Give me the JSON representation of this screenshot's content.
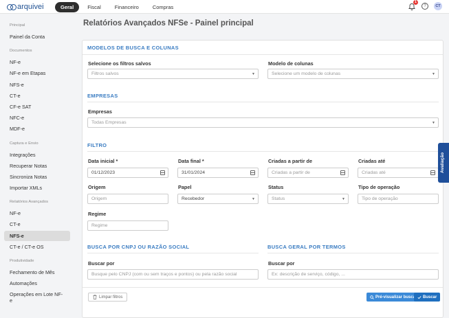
{
  "header": {
    "logo_text": "arquivei",
    "tabs": [
      {
        "label": "Geral"
      },
      {
        "label": "Fiscal"
      },
      {
        "label": "Financeiro"
      },
      {
        "label": "Compras"
      }
    ],
    "notification_count": "1",
    "help_label": "?",
    "avatar_initials": "CT"
  },
  "sidebar": {
    "principal": {
      "title": "Principal",
      "items": [
        "Painel da Conta"
      ]
    },
    "documentos": {
      "title": "Documentos",
      "items": [
        "NF-e",
        "NF-e em Etapas",
        "NFS-e",
        "CT-e",
        "CF-e SAT",
        "NFC-e",
        "MDF-e"
      ]
    },
    "captura": {
      "title": "Captura e Envio",
      "items": [
        "Integrações",
        "Recuperar Notas",
        "Sincroniza Notas",
        "Importar XMLs"
      ]
    },
    "relatorios": {
      "title": "Relatórios Avançados",
      "items": [
        "NF-e",
        "CT-e",
        "NFS-e",
        "CT-e / CT-e OS"
      ]
    },
    "produtividade": {
      "title": "Produtividade",
      "items": [
        "Fechamento de Mês",
        "Automações",
        "Operações em Lote NF-e"
      ]
    }
  },
  "page": {
    "title": "Relatórios Avançados NFSe - Painel principal"
  },
  "form": {
    "modelos": {
      "title": "MODELOS DE BUSCA E COLUNAS",
      "filtros_label": "Selecione os filtros salvos",
      "filtros_placeholder": "Filtros salvos",
      "colunas_label": "Modelo de colunas",
      "colunas_placeholder": "Selecione um modelo de colunas"
    },
    "empresas": {
      "title": "EMPRESAS",
      "label": "Empresas",
      "value": "Todas Empresas"
    },
    "filtro": {
      "title": "FILTRO",
      "data_inicial_label": "Data inicial *",
      "data_inicial_value": "01/12/2023",
      "data_final_label": "Data final *",
      "data_final_value": "31/01/2024",
      "criadas_a_partir_label": "Criadas a partir de",
      "criadas_a_partir_placeholder": "Criadas a partir de",
      "criadas_ate_label": "Criadas até",
      "criadas_ate_placeholder": "Criadas até",
      "origem_label": "Origem",
      "origem_placeholder": "Origem",
      "papel_label": "Papel",
      "papel_value": "Recebedor",
      "status_label": "Status",
      "status_placeholder": "Status",
      "tipo_operacao_label": "Tipo de operação",
      "tipo_operacao_placeholder": "Tipo de operação",
      "regime_label": "Regime",
      "regime_placeholder": "Regime"
    },
    "busca_cnpj": {
      "title": "BUSCA POR CNPJ OU RAZÃO SOCIAL",
      "label": "Buscar por",
      "placeholder": "Busque pelo CNPJ (com ou sem traços e pontos) ou pela razão social"
    },
    "busca_geral": {
      "title": "BUSCA GERAL POR TERMOS",
      "label": "Buscar por",
      "placeholder": "Ex: descrição de serviço, código, ..."
    },
    "buttons": {
      "clear": "Limpar filtros",
      "preview": "Pré-visualizar busca",
      "search": "Buscar"
    }
  },
  "feedback_tab": "Avaliação",
  "colors": {
    "accent": "#3a7cc2",
    "primary_button": "#1f6fbf",
    "secondary_button": "#3b8ad8",
    "feedback_tab": "#1f4f9a",
    "active_tab": "#2e2e2e"
  }
}
